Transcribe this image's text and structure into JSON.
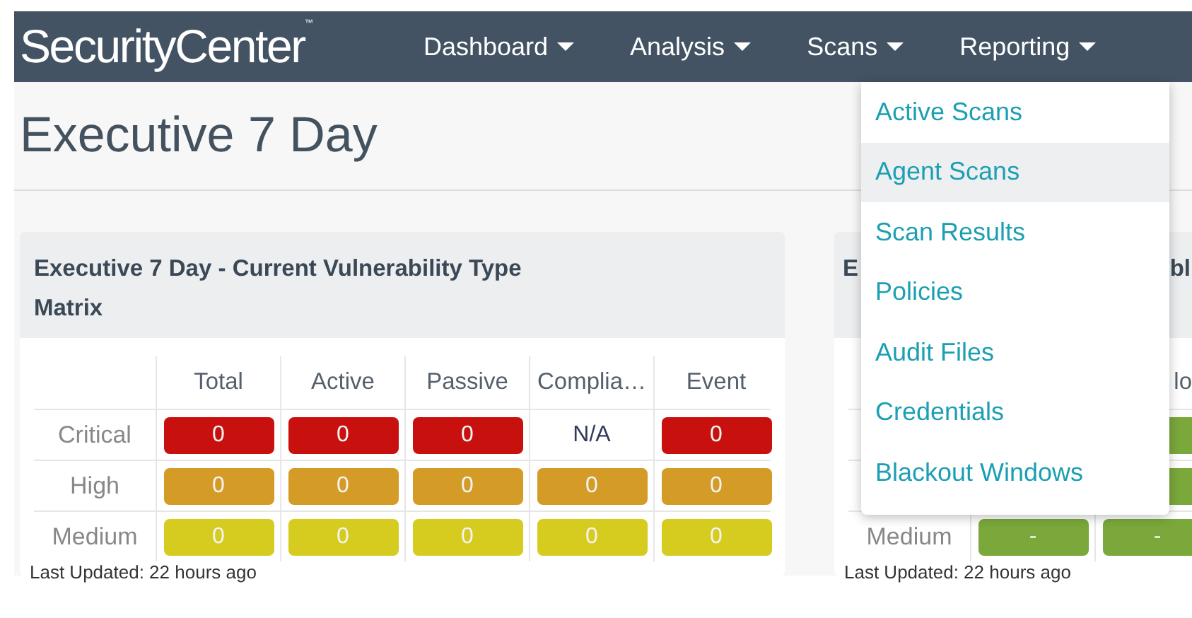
{
  "nav": {
    "logo": "SecurityCenter",
    "logo_mark": "™",
    "items": [
      {
        "label": "Dashboard"
      },
      {
        "label": "Analysis"
      },
      {
        "label": "Scans"
      },
      {
        "label": "Reporting"
      }
    ]
  },
  "scans_menu": {
    "items": [
      {
        "label": "Active Scans",
        "selected": false
      },
      {
        "label": "Agent Scans",
        "selected": true
      },
      {
        "label": "Scan Results",
        "selected": false
      },
      {
        "label": "Policies",
        "selected": false
      },
      {
        "label": "Audit Files",
        "selected": false
      },
      {
        "label": "Credentials",
        "selected": false
      },
      {
        "label": "Blackout Windows",
        "selected": false
      }
    ]
  },
  "page_title": "Executive 7 Day",
  "cards": [
    {
      "title": [
        "Executive 7 Day - Current Vulnerability Type",
        "Matrix"
      ],
      "columns": [
        "Total",
        "Active",
        "Passive",
        "Complia…",
        "Event"
      ],
      "rows": [
        {
          "label": "Critical",
          "color": "#c8110f",
          "cells": [
            {
              "kind": "pill",
              "value": "0"
            },
            {
              "kind": "pill",
              "value": "0"
            },
            {
              "kind": "pill",
              "value": "0"
            },
            {
              "kind": "plain",
              "value": "N/A"
            },
            {
              "kind": "pill",
              "value": "0"
            }
          ]
        },
        {
          "label": "High",
          "color": "#d49b26",
          "cells": [
            {
              "kind": "pill",
              "value": "0"
            },
            {
              "kind": "pill",
              "value": "0"
            },
            {
              "kind": "pill",
              "value": "0"
            },
            {
              "kind": "pill",
              "value": "0"
            },
            {
              "kind": "pill",
              "value": "0"
            }
          ]
        },
        {
          "label": "Medium",
          "color": "#d6cb1f",
          "cells": [
            {
              "kind": "pill",
              "value": "0"
            },
            {
              "kind": "pill",
              "value": "0"
            },
            {
              "kind": "pill",
              "value": "0"
            },
            {
              "kind": "pill",
              "value": "0"
            },
            {
              "kind": "pill",
              "value": "0"
            }
          ]
        }
      ],
      "footer": "Last Updated: 22 hours ago"
    },
    {
      "title_fragments": [
        {
          "left": "E",
          "right": "bl"
        }
      ],
      "column_fragment": "lo",
      "rows": [
        {
          "color": "#7aa83b",
          "cells": [
            {
              "kind": "covered"
            },
            {
              "kind": "pill"
            }
          ]
        },
        {
          "color": "#7aa83b",
          "cells": [
            {
              "kind": "covered"
            },
            {
              "kind": "pill"
            }
          ]
        },
        {
          "label": "Medium",
          "color": "#7aa83b",
          "cells": [
            {
              "kind": "pill",
              "value": "-"
            },
            {
              "kind": "pill",
              "value": "-"
            }
          ]
        }
      ],
      "footer": "Last Updated: 22 hours ago"
    }
  ]
}
